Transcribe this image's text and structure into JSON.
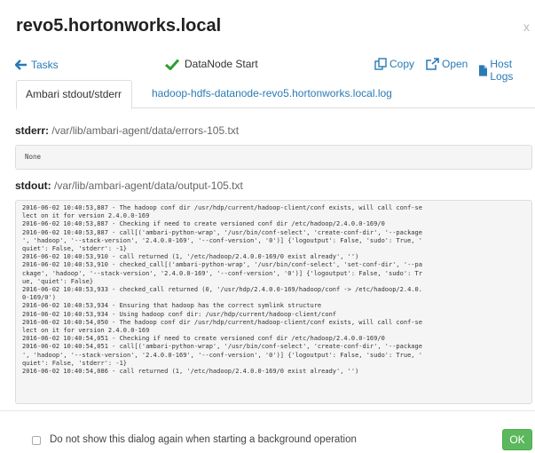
{
  "dialog": {
    "title": "revo5.hortonworks.local",
    "close_label": "x"
  },
  "toolbar": {
    "back_label": "Tasks",
    "task_name": "DataNode Start",
    "copy_label": "Copy",
    "open_label": "Open",
    "host_logs_label": "Host Logs"
  },
  "tabs": [
    {
      "label": "Ambari stdout/stderr",
      "active": true
    },
    {
      "label": "hadoop-hdfs-datanode-revo5.hortonworks.local.log",
      "active": false
    }
  ],
  "stderr": {
    "label": "stderr:",
    "path": "/var/lib/ambari-agent/data/errors-105.txt",
    "content": "None"
  },
  "stdout": {
    "label": "stdout:",
    "path": "/var/lib/ambari-agent/data/output-105.txt",
    "lines": [
      "2016-06-02 10:40:53,887 - The hadoop conf dir /usr/hdp/current/hadoop-client/conf exists, will call conf-se",
      "lect on it for version 2.4.0.0-169",
      "2016-06-02 10:40:53,887 - Checking if need to create versioned conf dir /etc/hadoop/2.4.0.0-169/0",
      "2016-06-02 10:40:53,887 - call[('ambari-python-wrap', '/usr/bin/conf-select', 'create-conf-dir', '--package",
      "', 'hadoop', '--stack-version', '2.4.0.0-169', '--conf-version', '0')] {'logoutput': False, 'sudo': True, '",
      "quiet': False, 'stderr': -1}",
      "2016-06-02 10:40:53,910 - call returned (1, '/etc/hadoop/2.4.0.0-169/0 exist already', '')",
      "2016-06-02 10:40:53,910 - checked_call[('ambari-python-wrap', '/usr/bin/conf-select', 'set-conf-dir', '--pa",
      "ckage', 'hadoop', '--stack-version', '2.4.0.0-169', '--conf-version', '0')] {'logoutput': False, 'sudo': Tr",
      "ue, 'quiet': False}",
      "2016-06-02 10:40:53,933 - checked_call returned (0, '/usr/hdp/2.4.0.0-169/hadoop/conf -> /etc/hadoop/2.4.0.",
      "0-169/0')",
      "2016-06-02 10:40:53,934 - Ensuring that hadoop has the correct symlink structure",
      "2016-06-02 10:40:53,934 - Using hadoop conf dir: /usr/hdp/current/hadoop-client/conf",
      "2016-06-02 10:40:54,050 - The hadoop conf dir /usr/hdp/current/hadoop-client/conf exists, will call conf-se",
      "lect on it for version 2.4.0.0-169",
      "2016-06-02 10:40:54,051 - Checking if need to create versioned conf dir /etc/hadoop/2.4.0.0-169/0",
      "2016-06-02 10:40:54,051 - call[('ambari-python-wrap', '/usr/bin/conf-select', 'create-conf-dir', '--package",
      "', 'hadoop', '--stack-version', '2.4.0.0-169', '--conf-version', '0')] {'logoutput': False, 'sudo': True, '",
      "quiet': False, 'stderr': -1}",
      "2016-06-02 10:40:54,086 - call returned (1, '/etc/hadoop/2.4.0.0-169/0 exist already', '')"
    ]
  },
  "footer": {
    "dont_show_label": "Do not show this dialog again when starting a background operation",
    "ok_label": "OK"
  },
  "colors": {
    "link": "#2a7ab5",
    "ok_button": "#5cb85c",
    "check": "#2e9e2e"
  },
  "icons": [
    "arrow-left-icon",
    "checkmark-icon",
    "copy-icon",
    "external-link-icon",
    "file-icon"
  ]
}
